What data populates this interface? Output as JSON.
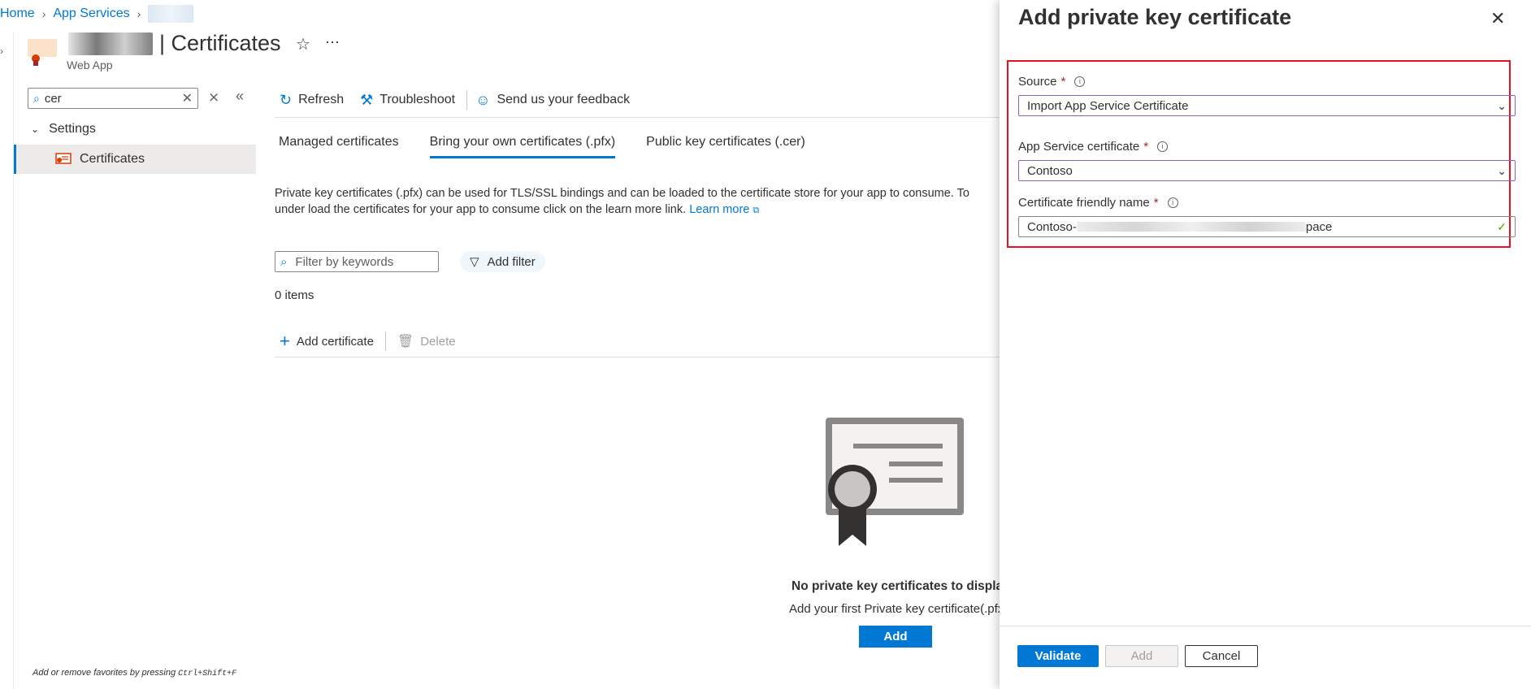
{
  "breadcrumb": {
    "home": "Home",
    "app_services": "App Services"
  },
  "header": {
    "title": "| Certificates",
    "subtitle": "Web App"
  },
  "nav": {
    "search_value": "cer",
    "group_label": "Settings",
    "items": [
      {
        "label": "Certificates"
      }
    ],
    "footer_hint_prefix": "Add or remove favorites by pressing ",
    "footer_hint_shortcut": "Ctrl+Shift+F"
  },
  "toolbar": {
    "refresh": "Refresh",
    "troubleshoot": "Troubleshoot",
    "feedback": "Send us your feedback"
  },
  "tabs": [
    {
      "label": "Managed certificates",
      "active": false
    },
    {
      "label": "Bring your own certificates (.pfx)",
      "active": true
    },
    {
      "label": "Public key certificates (.cer)",
      "active": false
    }
  ],
  "main": {
    "description": "Private key certificates (.pfx) can be used for TLS/SSL bindings and can be loaded to the certificate store for your app to consume. To under load the certificates for your app to consume click on the learn more link.",
    "learn_more": "Learn more",
    "filter_placeholder": "Filter by keywords",
    "add_filter": "Add filter",
    "item_count": "0 items",
    "add_certificate": "Add certificate",
    "delete": "Delete",
    "empty_title": "No private key certificates to display.",
    "empty_subtitle": "Add your first Private key certificate(.pfx)",
    "empty_add": "Add"
  },
  "panel": {
    "title": "Add private key certificate",
    "source_label": "Source",
    "source_value": "Import App Service Certificate",
    "cert_label": "App Service certificate",
    "cert_value": "Contoso",
    "friendly_label": "Certificate friendly name",
    "friendly_value_prefix": "Contoso-",
    "friendly_value_suffix": "pace",
    "validate": "Validate",
    "add": "Add",
    "cancel": "Cancel"
  },
  "colors": {
    "accent": "#0078d4",
    "highlight": "#e81123",
    "focus_border": "#8764b8"
  }
}
